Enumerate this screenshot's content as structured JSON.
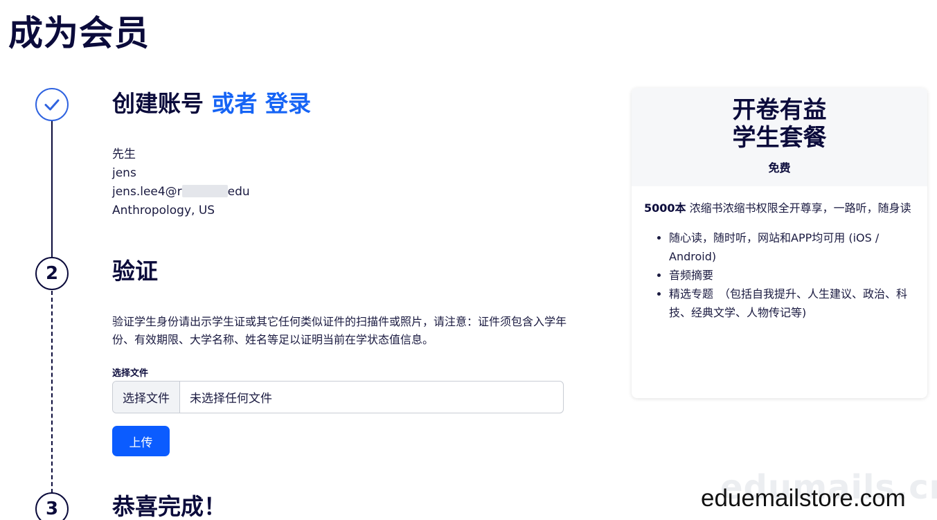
{
  "page": {
    "title": "成为会员"
  },
  "steps": [
    {
      "number": "",
      "state": "done",
      "title": "创建账号",
      "link_or": "或者",
      "link_login": "登录"
    },
    {
      "number": "2",
      "state": "current",
      "title": "验证"
    },
    {
      "number": "3",
      "state": "pending",
      "title": "恭喜完成！"
    }
  ],
  "account": {
    "salutation": "先生",
    "name": "jens",
    "email_prefix": "jens.lee4@r",
    "email_suffix": "edu",
    "field_location": "Anthropology, US"
  },
  "verify": {
    "description": "验证学生身份请出示学生证或其它任何类似证件的扫描件或照片，请注意：证件须包含入学年份、有效期限、大学名称、姓名等足以证明当前在学状态值信息。",
    "file_label": "选择文件",
    "file_button": "选择文件",
    "file_placeholder": "未选择任何文件",
    "upload_button": "上传"
  },
  "plan": {
    "title_line1": "开卷有益",
    "title_line2": "学生套餐",
    "price": "免费",
    "intro_bold": "5000本",
    "intro_text": " 浓缩书浓缩书权限全开尊享，一路听，随身读",
    "features": [
      "随心读，随时听，网站和APP均可用 (iOS / Android)",
      "音频摘要",
      "精选专题　（包括自我提升、人生建议、政治、科技、经典文学、人物传记等)"
    ]
  },
  "watermarks": {
    "faded": "edumails.cn",
    "main": "eduemailstore.com"
  },
  "colors": {
    "accent": "#0b5cff",
    "link": "#1664f5",
    "navy": "#0b0b3b"
  },
  "icons": {
    "step1": "check-icon"
  }
}
